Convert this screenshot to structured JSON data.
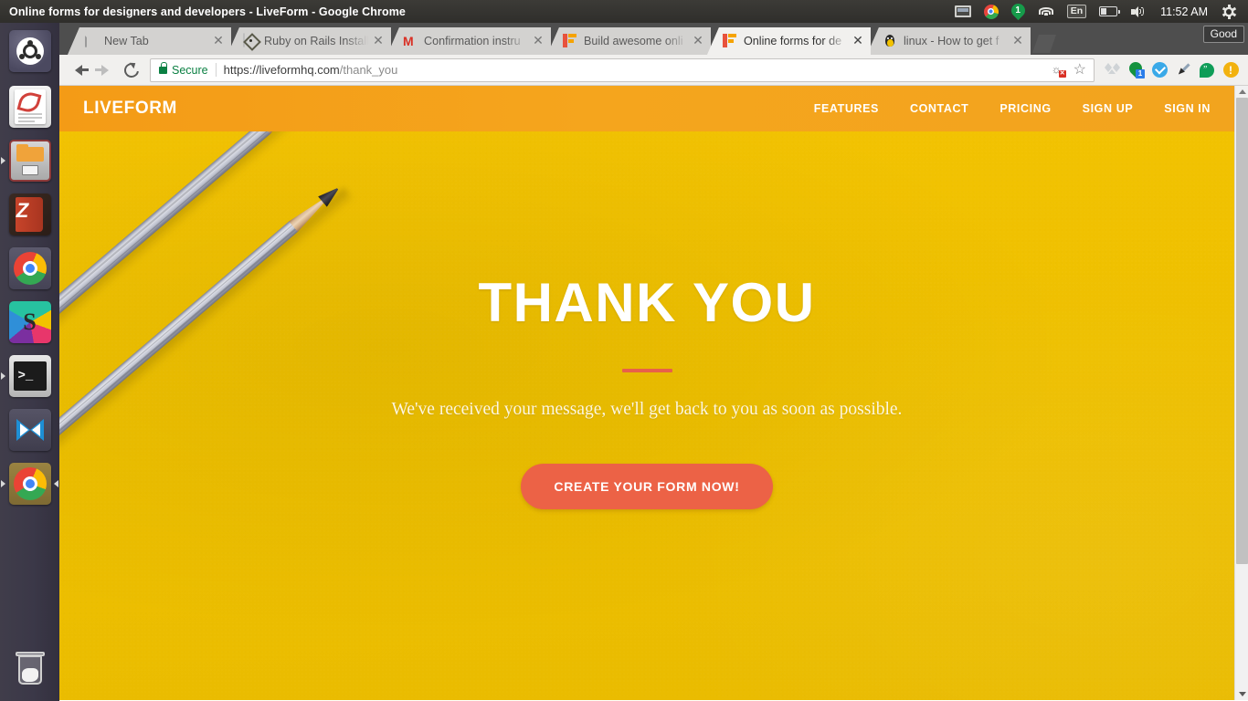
{
  "desktop": {
    "panel_title": "Online forms for designers and developers - LiveForm - Google Chrome",
    "clock": "11:52 AM",
    "tray": [
      {
        "name": "display-icon",
        "label": "Display"
      },
      {
        "name": "chrome-indicator-icon",
        "label": "Chrome"
      },
      {
        "name": "notification-count-icon",
        "label": "1"
      },
      {
        "name": "wifi-icon",
        "label": "Wi-Fi"
      },
      {
        "name": "keyboard-layout-icon",
        "label": "En"
      },
      {
        "name": "battery-icon",
        "label": "Battery"
      },
      {
        "name": "volume-icon",
        "label": "Volume"
      },
      {
        "name": "system-menu-icon",
        "label": "System"
      }
    ]
  },
  "launcher": {
    "items": [
      {
        "name": "ubuntu-dash-icon",
        "label": "Dash home",
        "state": "idle"
      },
      {
        "name": "evernote-icon",
        "label": "Evernote",
        "state": "idle"
      },
      {
        "name": "files-icon",
        "label": "Files",
        "state": "running"
      },
      {
        "name": "zotero-icon",
        "label": "Zotero",
        "state": "idle"
      },
      {
        "name": "chrome-icon",
        "label": "Google Chrome",
        "state": "idle"
      },
      {
        "name": "sublime-text-icon",
        "label": "Sublime Text",
        "state": "idle"
      },
      {
        "name": "terminal-icon",
        "label": "Terminal",
        "state": "running"
      },
      {
        "name": "vscode-icon",
        "label": "Visual Studio Code",
        "state": "idle"
      },
      {
        "name": "chrome-window-icon",
        "label": "Google Chrome",
        "state": "focused"
      },
      {
        "name": "trash-icon",
        "label": "Trash",
        "state": "idle"
      }
    ]
  },
  "browser": {
    "good_badge": "Good",
    "tabs": [
      {
        "title": "New Tab",
        "favicon": "page-icon",
        "active": false
      },
      {
        "title": "Ruby on Rails Install",
        "favicon": "rails-icon",
        "active": false
      },
      {
        "title": "Confirmation instru",
        "favicon": "gmail-icon",
        "active": false
      },
      {
        "title": "Build awesome onli",
        "favicon": "liveform-icon",
        "active": false
      },
      {
        "title": "Online forms for de",
        "favicon": "liveform-icon",
        "active": true
      },
      {
        "title": "linux - How to get f",
        "favicon": "linux-icon",
        "active": false
      }
    ],
    "new_tab_label": "New tab",
    "nav": {
      "back_label": "Back",
      "forward_label": "Forward",
      "reload_label": "Reload"
    },
    "omnibox": {
      "security_label": "Secure",
      "url_origin": "https://liveformhq.com",
      "url_path": "/thank_you",
      "translate_label": "Translate",
      "bookmark_label": "Bookmark this page"
    },
    "extensions": [
      {
        "name": "dropbox-extension-icon",
        "label": "Dropbox"
      },
      {
        "name": "pin-extension-icon",
        "label": "Pin",
        "badge": "1"
      },
      {
        "name": "check-extension-icon",
        "label": "Verify"
      },
      {
        "name": "eyedropper-extension-icon",
        "label": "ColorPick Eyedropper"
      },
      {
        "name": "hangouts-extension-icon",
        "label": "Hangouts"
      },
      {
        "name": "alert-extension-icon",
        "label": "Alert"
      }
    ]
  },
  "site": {
    "brand": "LIVEFORM",
    "nav_links": [
      {
        "label": "FEATURES"
      },
      {
        "label": "CONTACT"
      },
      {
        "label": "PRICING"
      },
      {
        "label": "SIGN UP"
      },
      {
        "label": "SIGN IN"
      }
    ],
    "hero": {
      "title": "THANK YOU",
      "subtitle": "We've received your message, we'll get back to you as soon as possible.",
      "cta": "CREATE YOUR FORM NOW!"
    },
    "colors": {
      "header_orange": "#f5a51d",
      "hero_yellow": "#f2c200",
      "accent_coral": "#ec6246",
      "rule_coral": "#e8604a",
      "text_white": "#ffffff"
    }
  }
}
